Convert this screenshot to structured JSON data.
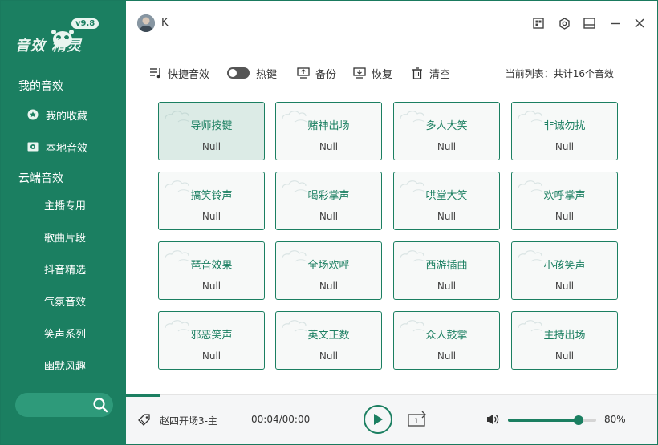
{
  "app": {
    "logo_text": "音效   精灵",
    "version": "v9.8"
  },
  "sidebar": {
    "heading_my": "我的音效",
    "my_items": [
      {
        "label": "我的收藏",
        "icon": "favorite-icon"
      },
      {
        "label": "本地音效",
        "icon": "local-icon"
      }
    ],
    "heading_cloud": "云端音效",
    "cloud_items": [
      "主播专用",
      "歌曲片段",
      "抖音精选",
      "气氛音效",
      "笑声系列",
      "幽默风趣"
    ],
    "search_placeholder": ""
  },
  "topbar": {
    "username": "K"
  },
  "toolbar": {
    "quick_label": "快捷音效",
    "hotkey_label": "热键",
    "backup_label": "备份",
    "restore_label": "恢复",
    "clear_label": "清空",
    "list_info": "当前列表：共计16个音效"
  },
  "cards": [
    {
      "name": "导师按键",
      "sub": "Null"
    },
    {
      "name": "赌神出场",
      "sub": "Null"
    },
    {
      "name": "多人大笑",
      "sub": "Null"
    },
    {
      "name": "非诚勿扰",
      "sub": "Null"
    },
    {
      "name": "搞笑铃声",
      "sub": "Null"
    },
    {
      "name": "喝彩掌声",
      "sub": "Null"
    },
    {
      "name": "哄堂大笑",
      "sub": "Null"
    },
    {
      "name": "欢呼掌声",
      "sub": "Null"
    },
    {
      "name": "琶音效果",
      "sub": "Null"
    },
    {
      "name": "全场欢呼",
      "sub": "Null"
    },
    {
      "name": "西游插曲",
      "sub": "Null"
    },
    {
      "name": "小孩笑声",
      "sub": "Null"
    },
    {
      "name": "邪恶笑声",
      "sub": "Null"
    },
    {
      "name": "英文正数",
      "sub": "Null"
    },
    {
      "name": "众人鼓掌",
      "sub": "Null"
    },
    {
      "name": "主持出场",
      "sub": "Null"
    }
  ],
  "player": {
    "track": "赵四开场3-主",
    "time": "00:04/00:00",
    "volume_label": "80%",
    "volume": 0.8
  },
  "colors": {
    "accent": "#1b7f61"
  }
}
